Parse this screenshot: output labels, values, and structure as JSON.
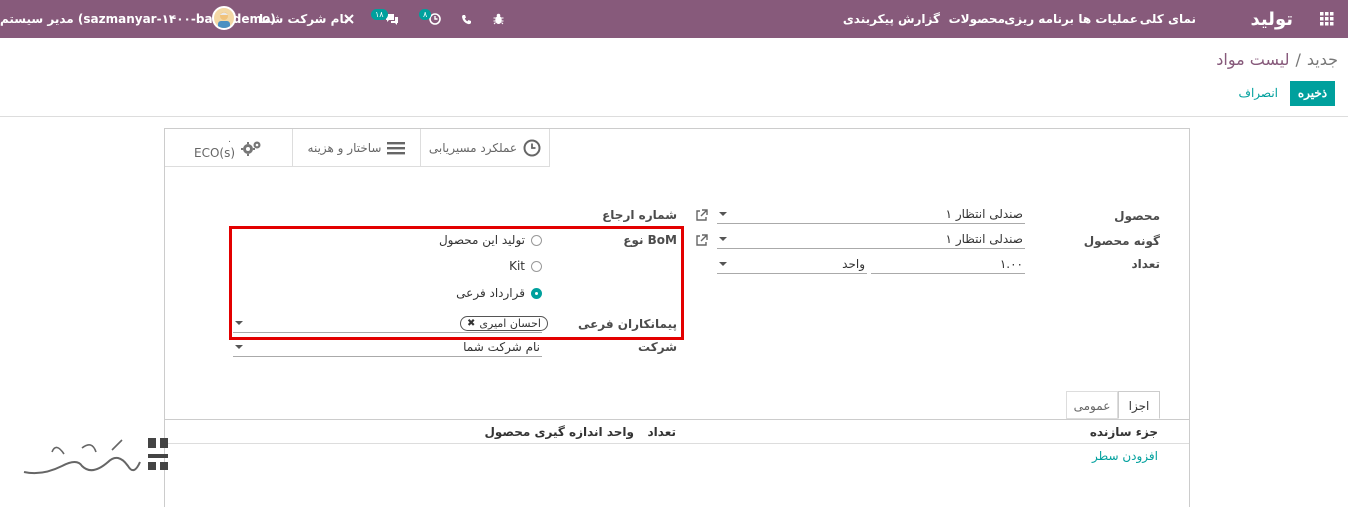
{
  "navbar": {
    "brand": "تولید",
    "menu": [
      "نمای کلی",
      "عملیات ها",
      "برنامه ریزی",
      "محصولات",
      "گزارش",
      "پیکربندی"
    ],
    "activity_count": "۸",
    "message_count": "۱۸",
    "company": "نام شرکت شما",
    "user": "مدیر سیستم (sazmanyar-۱۴۰۰-base-demo)"
  },
  "breadcrumb": {
    "parent": "لیست مواد",
    "separator": "/",
    "current": "جدید"
  },
  "actions": {
    "save": "ذخیره",
    "discard": "انصراف"
  },
  "smart_buttons": {
    "routing": "عملکرد مسیریابی",
    "structure": "ساختار و هزینه",
    "eco_count": "۰",
    "eco_label": "ECO(s)"
  },
  "form": {
    "product_label": "محصول",
    "product_value": "صندلی انتظار ۱",
    "variant_label": "گونه محصول",
    "variant_value": "صندلی انتظار ۱",
    "quantity_label": "تعداد",
    "quantity_value": "۱.۰۰",
    "uom_value": "واحد",
    "reference_label": "شماره ارجاع",
    "bom_type_label": "نوع BoM",
    "bom_type_options": [
      "تولید این محصول",
      "Kit",
      "قرارداد فرعی"
    ],
    "subcontractors_label": "پیمانکاران فرعی",
    "subcontractor_tag": "احسان امیری",
    "company_label": "شرکت",
    "company_value": "نام شرکت شما"
  },
  "tabs": {
    "components": "اجزا",
    "general": "عمومی"
  },
  "table": {
    "headers": {
      "component": "جزء سازنده",
      "quantity": "تعداد",
      "uom": "واحد اندازه گیری محصول"
    },
    "add_line": "افزودن سطر"
  },
  "colors": {
    "navbar": "#875a7b",
    "accent": "#00a09d",
    "highlight": "#e30000"
  }
}
